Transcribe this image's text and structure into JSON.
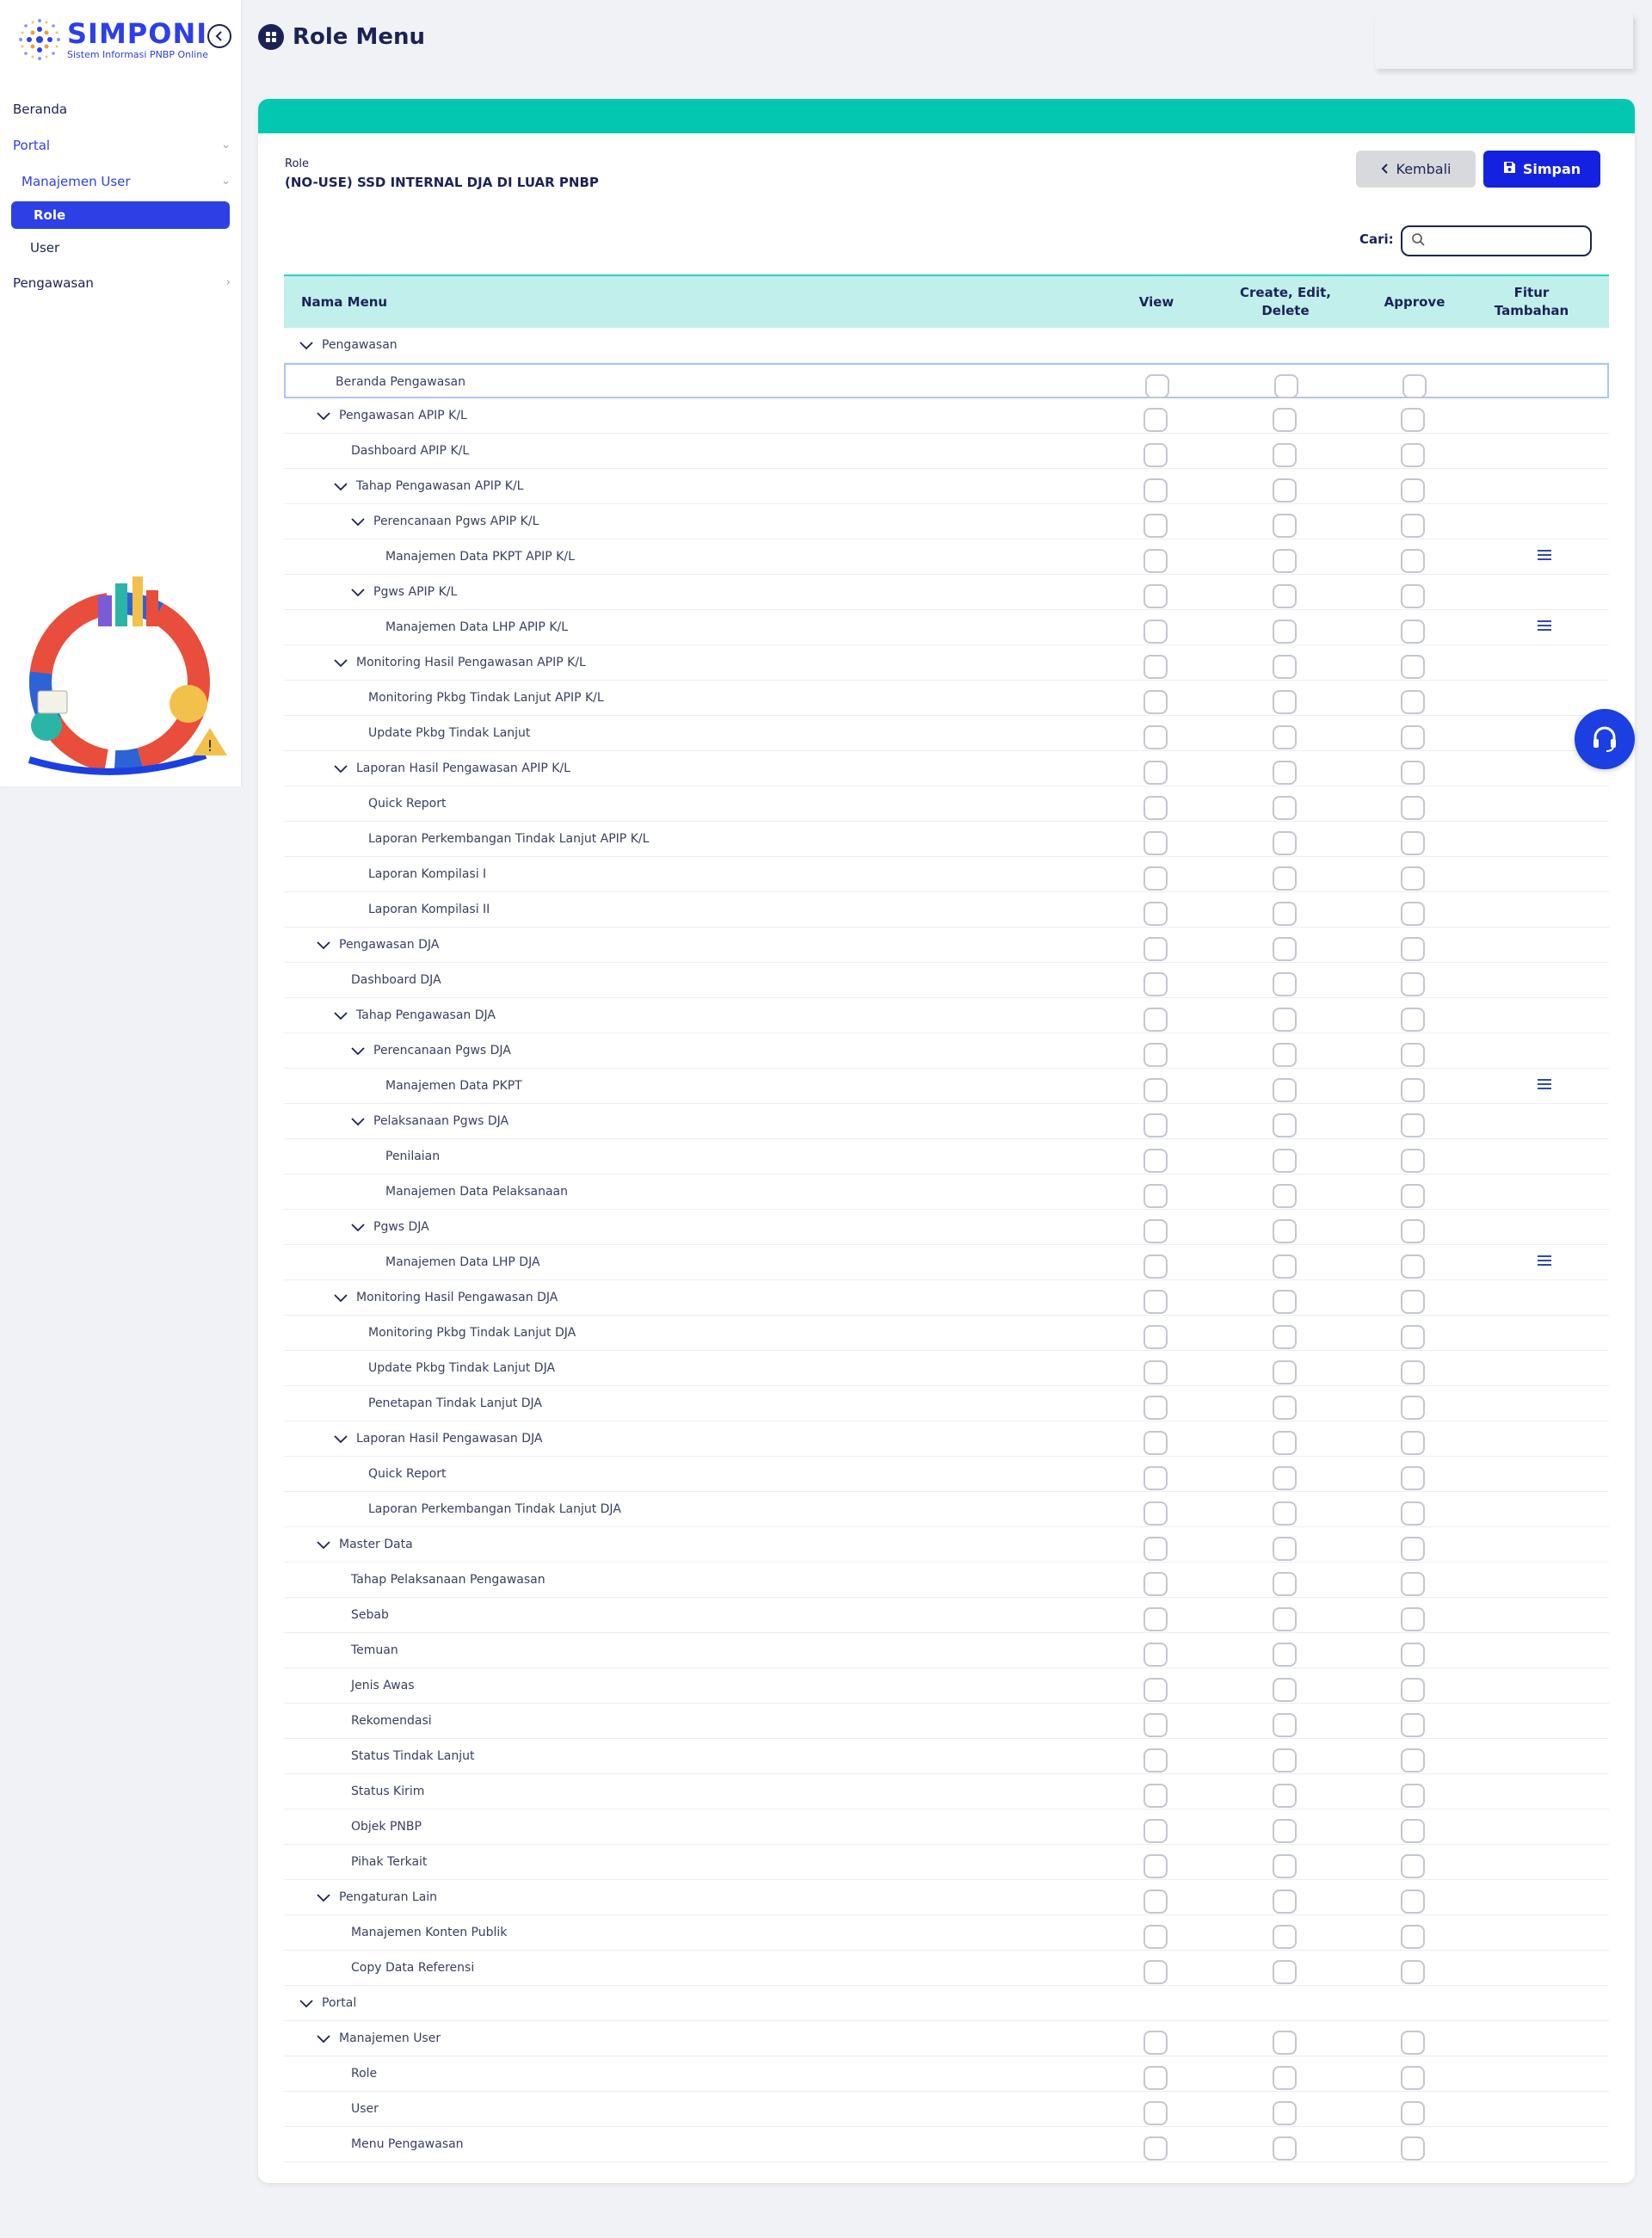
{
  "app": {
    "name": "SIMPONI",
    "subtitle": "Sistem Informasi PNBP Online"
  },
  "sidebar": {
    "items": [
      {
        "label": "Beranda"
      },
      {
        "label": "Portal"
      },
      {
        "label": "Manajemen User"
      },
      {
        "label": "Role"
      },
      {
        "label": "User"
      },
      {
        "label": "Pengawasan"
      }
    ]
  },
  "header": {
    "title": "Role Menu"
  },
  "card": {
    "role_label": "Role",
    "role_value": "(NO-USE) SSD INTERNAL DJA DI LUAR PNBP",
    "back_label": "Kembali",
    "save_label": "Simpan",
    "search_label": "Cari:",
    "search_value": ""
  },
  "table": {
    "headers": {
      "name": "Nama Menu",
      "view": "View",
      "ced": "Create, Edit, Delete",
      "approve": "Approve",
      "extra": "Fitur Tambahan"
    },
    "rows": [
      {
        "label": "Pengawasan",
        "level": 0,
        "expandable": true,
        "checkboxes": false,
        "extra": false
      },
      {
        "label": "Beranda Pengawasan",
        "level": 1,
        "expandable": false,
        "checkboxes": true,
        "extra": false,
        "selected": true
      },
      {
        "label": "Pengawasan APIP K/L",
        "level": 1,
        "expandable": true,
        "checkboxes": true,
        "extra": false
      },
      {
        "label": "Dashboard APIP K/L",
        "level": 2,
        "expandable": false,
        "checkboxes": true,
        "extra": false
      },
      {
        "label": "Tahap Pengawasan APIP K/L",
        "level": 2,
        "expandable": true,
        "checkboxes": true,
        "extra": false
      },
      {
        "label": "Perencanaan Pgws APIP K/L",
        "level": 3,
        "expandable": true,
        "checkboxes": true,
        "extra": false
      },
      {
        "label": "Manajemen Data PKPT APIP K/L",
        "level": 4,
        "expandable": false,
        "checkboxes": true,
        "extra": true
      },
      {
        "label": "Pgws APIP K/L",
        "level": 3,
        "expandable": true,
        "checkboxes": true,
        "extra": false
      },
      {
        "label": "Manajemen Data LHP APIP K/L",
        "level": 4,
        "expandable": false,
        "checkboxes": true,
        "extra": true
      },
      {
        "label": "Monitoring Hasil Pengawasan APIP K/L",
        "level": 2,
        "expandable": true,
        "checkboxes": true,
        "extra": false
      },
      {
        "label": "Monitoring Pkbg Tindak Lanjut APIP K/L",
        "level": 3,
        "expandable": false,
        "checkboxes": true,
        "extra": false
      },
      {
        "label": "Update Pkbg Tindak Lanjut",
        "level": 3,
        "expandable": false,
        "checkboxes": true,
        "extra": false
      },
      {
        "label": "Laporan Hasil Pengawasan APIP K/L",
        "level": 2,
        "expandable": true,
        "checkboxes": true,
        "extra": false
      },
      {
        "label": "Quick Report",
        "level": 3,
        "expandable": false,
        "checkboxes": true,
        "extra": false
      },
      {
        "label": "Laporan Perkembangan Tindak Lanjut APIP K/L",
        "level": 3,
        "expandable": false,
        "checkboxes": true,
        "extra": false
      },
      {
        "label": "Laporan Kompilasi I",
        "level": 3,
        "expandable": false,
        "checkboxes": true,
        "extra": false
      },
      {
        "label": "Laporan Kompilasi II",
        "level": 3,
        "expandable": false,
        "checkboxes": true,
        "extra": false
      },
      {
        "label": "Pengawasan DJA",
        "level": 1,
        "expandable": true,
        "checkboxes": true,
        "extra": false
      },
      {
        "label": "Dashboard DJA",
        "level": 2,
        "expandable": false,
        "checkboxes": true,
        "extra": false
      },
      {
        "label": "Tahap Pengawasan DJA",
        "level": 2,
        "expandable": true,
        "checkboxes": true,
        "extra": false
      },
      {
        "label": "Perencanaan Pgws DJA",
        "level": 3,
        "expandable": true,
        "checkboxes": true,
        "extra": false
      },
      {
        "label": "Manajemen Data PKPT",
        "level": 4,
        "expandable": false,
        "checkboxes": true,
        "extra": true
      },
      {
        "label": "Pelaksanaan Pgws DJA",
        "level": 3,
        "expandable": true,
        "checkboxes": true,
        "extra": false
      },
      {
        "label": "Penilaian",
        "level": 4,
        "expandable": false,
        "checkboxes": true,
        "extra": false
      },
      {
        "label": "Manajemen Data Pelaksanaan",
        "level": 4,
        "expandable": false,
        "checkboxes": true,
        "extra": false
      },
      {
        "label": "Pgws DJA",
        "level": 3,
        "expandable": true,
        "checkboxes": true,
        "extra": false
      },
      {
        "label": "Manajemen Data LHP DJA",
        "level": 4,
        "expandable": false,
        "checkboxes": true,
        "extra": true
      },
      {
        "label": "Monitoring Hasil Pengawasan DJA",
        "level": 2,
        "expandable": true,
        "checkboxes": true,
        "extra": false
      },
      {
        "label": "Monitoring Pkbg Tindak Lanjut DJA",
        "level": 3,
        "expandable": false,
        "checkboxes": true,
        "extra": false
      },
      {
        "label": "Update Pkbg Tindak Lanjut DJA",
        "level": 3,
        "expandable": false,
        "checkboxes": true,
        "extra": false
      },
      {
        "label": "Penetapan Tindak Lanjut DJA",
        "level": 3,
        "expandable": false,
        "checkboxes": true,
        "extra": false
      },
      {
        "label": "Laporan Hasil Pengawasan DJA",
        "level": 2,
        "expandable": true,
        "checkboxes": true,
        "extra": false
      },
      {
        "label": "Quick Report",
        "level": 3,
        "expandable": false,
        "checkboxes": true,
        "extra": false
      },
      {
        "label": "Laporan Perkembangan Tindak Lanjut DJA",
        "level": 3,
        "expandable": false,
        "checkboxes": true,
        "extra": false
      },
      {
        "label": "Master Data",
        "level": 1,
        "expandable": true,
        "checkboxes": true,
        "extra": false
      },
      {
        "label": "Tahap Pelaksanaan Pengawasan",
        "level": 2,
        "expandable": false,
        "checkboxes": true,
        "extra": false
      },
      {
        "label": "Sebab",
        "level": 2,
        "expandable": false,
        "checkboxes": true,
        "extra": false
      },
      {
        "label": "Temuan",
        "level": 2,
        "expandable": false,
        "checkboxes": true,
        "extra": false
      },
      {
        "label": "Jenis Awas",
        "level": 2,
        "expandable": false,
        "checkboxes": true,
        "extra": false
      },
      {
        "label": "Rekomendasi",
        "level": 2,
        "expandable": false,
        "checkboxes": true,
        "extra": false
      },
      {
        "label": "Status Tindak Lanjut",
        "level": 2,
        "expandable": false,
        "checkboxes": true,
        "extra": false
      },
      {
        "label": "Status Kirim",
        "level": 2,
        "expandable": false,
        "checkboxes": true,
        "extra": false
      },
      {
        "label": "Objek PNBP",
        "level": 2,
        "expandable": false,
        "checkboxes": true,
        "extra": false
      },
      {
        "label": "Pihak Terkait",
        "level": 2,
        "expandable": false,
        "checkboxes": true,
        "extra": false
      },
      {
        "label": "Pengaturan Lain",
        "level": 1,
        "expandable": true,
        "checkboxes": true,
        "extra": false
      },
      {
        "label": "Manajemen Konten Publik",
        "level": 2,
        "expandable": false,
        "checkboxes": true,
        "extra": false
      },
      {
        "label": "Copy Data Referensi",
        "level": 2,
        "expandable": false,
        "checkboxes": true,
        "extra": false
      },
      {
        "label": "Portal",
        "level": 0,
        "expandable": true,
        "checkboxes": false,
        "extra": false
      },
      {
        "label": "Manajemen User",
        "level": 1,
        "expandable": true,
        "checkboxes": true,
        "extra": false
      },
      {
        "label": "Role",
        "level": 2,
        "expandable": false,
        "checkboxes": true,
        "extra": false
      },
      {
        "label": "User",
        "level": 2,
        "expandable": false,
        "checkboxes": true,
        "extra": false
      },
      {
        "label": "Menu Pengawasan",
        "level": 2,
        "expandable": false,
        "checkboxes": true,
        "extra": false
      }
    ]
  },
  "colors": {
    "primary": "#2e3fe6",
    "teal": "#04c7b2",
    "header_bg": "#c0efec",
    "save": "#1521e0",
    "text": "#1b2356"
  },
  "icons": [
    "collapse-icon",
    "grid-icon",
    "chevron-left-icon",
    "save-icon",
    "search-icon",
    "chevron-down-icon",
    "menu-lines-icon",
    "headset-icon"
  ]
}
